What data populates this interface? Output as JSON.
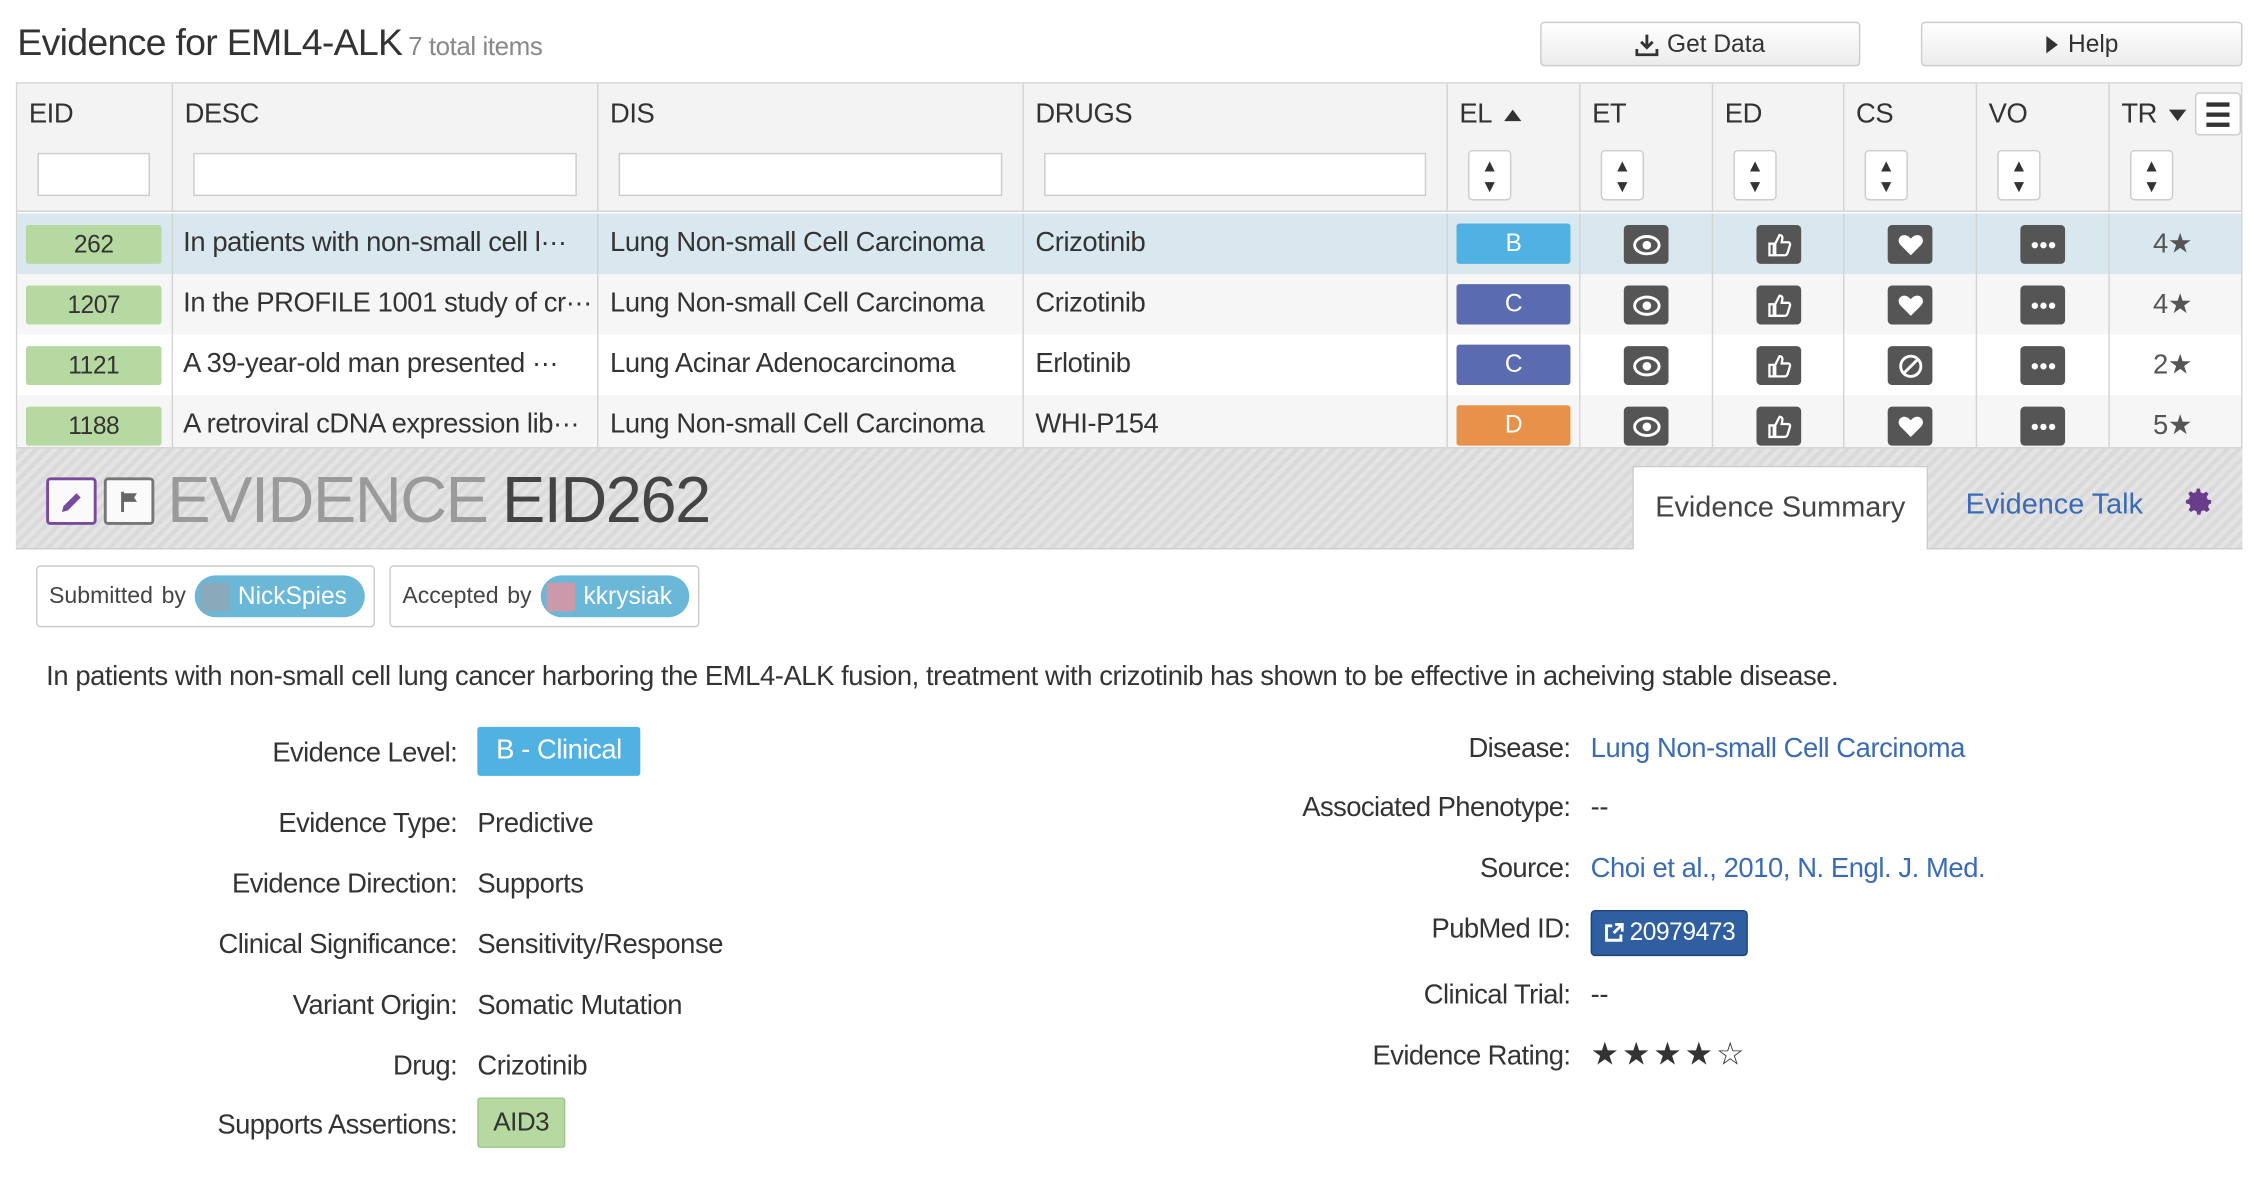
{
  "header": {
    "title": "Evidence for EML4-ALK",
    "count": "7 total items",
    "get_data": "Get Data",
    "help": "Help"
  },
  "columns": {
    "eid": "EID",
    "desc": "DESC",
    "dis": "DIS",
    "drugs": "DRUGS",
    "el": "EL",
    "et": "ET",
    "ed": "ED",
    "cs": "CS",
    "vo": "VO",
    "tr": "TR"
  },
  "rows": [
    {
      "eid": "262",
      "desc": "In patients with non-small cell l···",
      "dis": "Lung Non-small Cell Carcinoma",
      "drug": "Crizotinib",
      "el": "B",
      "el_color": "#4fb2e3",
      "cs_icon": "heart-icon",
      "tr": "4★"
    },
    {
      "eid": "1207",
      "desc": "In the PROFILE 1001 study of cr···",
      "dis": "Lung Non-small Cell Carcinoma",
      "drug": "Crizotinib",
      "el": "C",
      "el_color": "#5b6bb0",
      "cs_icon": "heart-icon",
      "tr": "4★"
    },
    {
      "eid": "1121",
      "desc": "A 39-year-old man presented ···",
      "dis": "Lung Acinar Adenocarcinoma",
      "drug": "Erlotinib",
      "el": "C",
      "el_color": "#5b6bb0",
      "cs_icon": "ban-icon",
      "tr": "2★"
    },
    {
      "eid": "1188",
      "desc": "A retroviral cDNA expression lib···",
      "dis": "Lung Non-small Cell Carcinoma",
      "drug": "WHI-P154",
      "el": "D",
      "el_color": "#e8914a",
      "cs_icon": "heart-icon",
      "tr": "5★"
    }
  ],
  "detail": {
    "title_prefix": "EVIDENCE",
    "title_id": "EID262",
    "tab_summary": "Evidence Summary",
    "tab_talk": "Evidence Talk",
    "submitted_label": "Submitted",
    "accepted_label": "Accepted",
    "by": "by",
    "submitter": "NickSpies",
    "accepter": "kkrysiak",
    "description": "In patients with non-small cell lung cancer harboring the EML4-ALK fusion, treatment with crizotinib has shown to be effective in acheiving stable disease.",
    "left": {
      "evidence_level_label": "Evidence Level:",
      "evidence_level": "B - Clinical",
      "evidence_type_label": "Evidence Type:",
      "evidence_type": "Predictive",
      "evidence_direction_label": "Evidence Direction:",
      "evidence_direction": "Supports",
      "clinical_significance_label": "Clinical Significance:",
      "clinical_significance": "Sensitivity/Response",
      "variant_origin_label": "Variant Origin:",
      "variant_origin": "Somatic Mutation",
      "drug_label": "Drug:",
      "drug": "Crizotinib",
      "supports_assertions_label": "Supports Assertions:",
      "supports_assertions": "AID3"
    },
    "right": {
      "disease_label": "Disease:",
      "disease": "Lung Non-small Cell Carcinoma",
      "phenotype_label": "Associated Phenotype:",
      "phenotype": "--",
      "source_label": "Source:",
      "source": "Choi et al., 2010, N. Engl. J. Med.",
      "pubmed_label": "PubMed ID:",
      "pubmed": "20979473",
      "trial_label": "Clinical Trial:",
      "trial": "--",
      "rating_label": "Evidence Rating:",
      "rating": "★★★★☆"
    }
  }
}
